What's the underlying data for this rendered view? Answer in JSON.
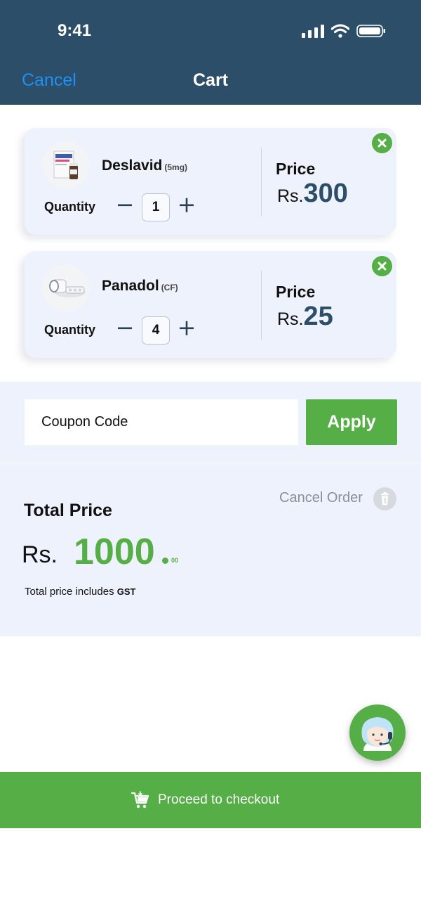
{
  "status_bar": {
    "time": "9:41"
  },
  "header": {
    "cancel_label": "Cancel",
    "title": "Cart"
  },
  "cart": {
    "items": [
      {
        "name": "Deslavid",
        "dose": "(5mg)",
        "quantity_label": "Quantity",
        "quantity": "1",
        "price_label": "Price",
        "currency": "Rs.",
        "price": "300"
      },
      {
        "name": "Panadol",
        "dose": "(CF)",
        "quantity_label": "Quantity",
        "quantity": "4",
        "price_label": "Price",
        "currency": "Rs.",
        "price": "25"
      }
    ]
  },
  "coupon": {
    "placeholder": "Coupon Code",
    "apply_label": "Apply"
  },
  "total": {
    "title": "Total Price",
    "cancel_order_label": "Cancel Order",
    "currency": "Rs.",
    "amount": "1000",
    "cents": "00",
    "note_prefix": "Total price includes ",
    "note_bold": "GST"
  },
  "checkout": {
    "label": "Proceed to checkout"
  },
  "colors": {
    "header": "#2d4e68",
    "accent": "#56ae47",
    "link": "#1d8ff5",
    "card_bg": "#edf2fd",
    "price_text": "#2d4e68"
  },
  "icons": [
    "signal-icon",
    "wifi-icon",
    "battery-icon",
    "remove-icon",
    "minus-icon",
    "plus-icon",
    "trash-icon",
    "cart-icon",
    "support-agent-icon"
  ]
}
